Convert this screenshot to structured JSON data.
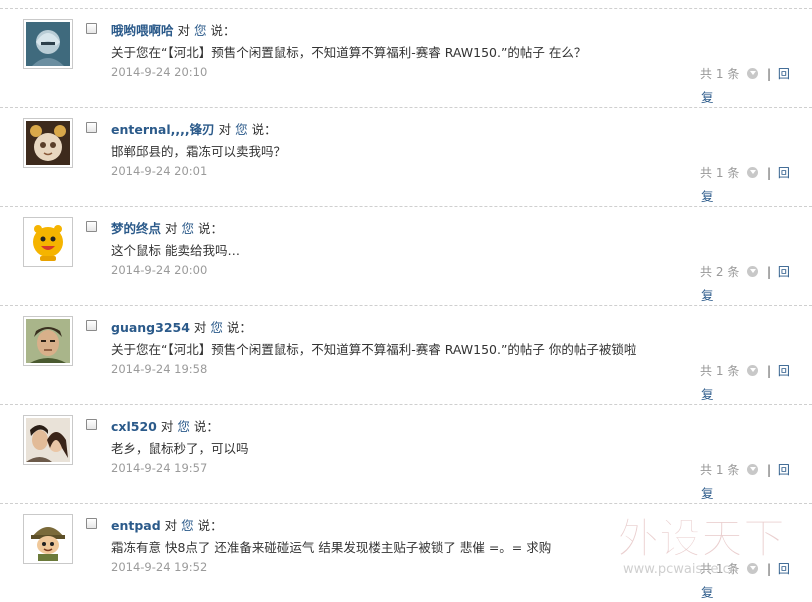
{
  "labels": {
    "to": "对",
    "you": "您",
    "said": "说：",
    "count_prefix": "共",
    "count_suffix": "条",
    "separator": "|",
    "reply_a": "回",
    "reply_b": "复"
  },
  "comments": [
    {
      "user": "哦哟喂啊哈",
      "message": "关于您在“【河北】预售个闲置鼠标，不知道算不算福利-赛睿 RAW150.”的帖子 在么？",
      "time": "2014-9-24 20:10",
      "count": "1",
      "avatar": "knight-helmet-avatar"
    },
    {
      "user": "enternal,,,,锋刃",
      "message": "邯郸邱县的，霜冻可以卖我吗？",
      "time": "2014-9-24 20:01",
      "count": "1",
      "avatar": "cartoon-cat-avatar"
    },
    {
      "user": "梦的终点",
      "message": "这个鼠标 能卖给我吗…",
      "time": "2014-9-24 20:00",
      "count": "2",
      "avatar": "yellow-mascot-avatar"
    },
    {
      "user": "guang3254",
      "message": "关于您在“【河北】预售个闲置鼠标，不知道算不算福利-赛睿 RAW150.”的帖子 你的帖子被锁啦",
      "time": "2014-9-24 19:58",
      "count": "1",
      "avatar": "anime-man-avatar"
    },
    {
      "user": "cxl520",
      "message": "老乡，鼠标秒了，可以吗",
      "time": "2014-9-24 19:57",
      "count": "1",
      "avatar": "couple-photo-avatar"
    },
    {
      "user": "entpad",
      "message": "霜冻有意 快8点了 还准备来碰碰运气 结果发现楼主贴子被锁了 悲催 =。= 求购",
      "time": "2014-9-24 19:52",
      "count": "1",
      "avatar": "soldier-cartoon-avatar"
    }
  ],
  "watermark": {
    "title": "外设天下",
    "url": "www.pcwaishe.cn"
  }
}
